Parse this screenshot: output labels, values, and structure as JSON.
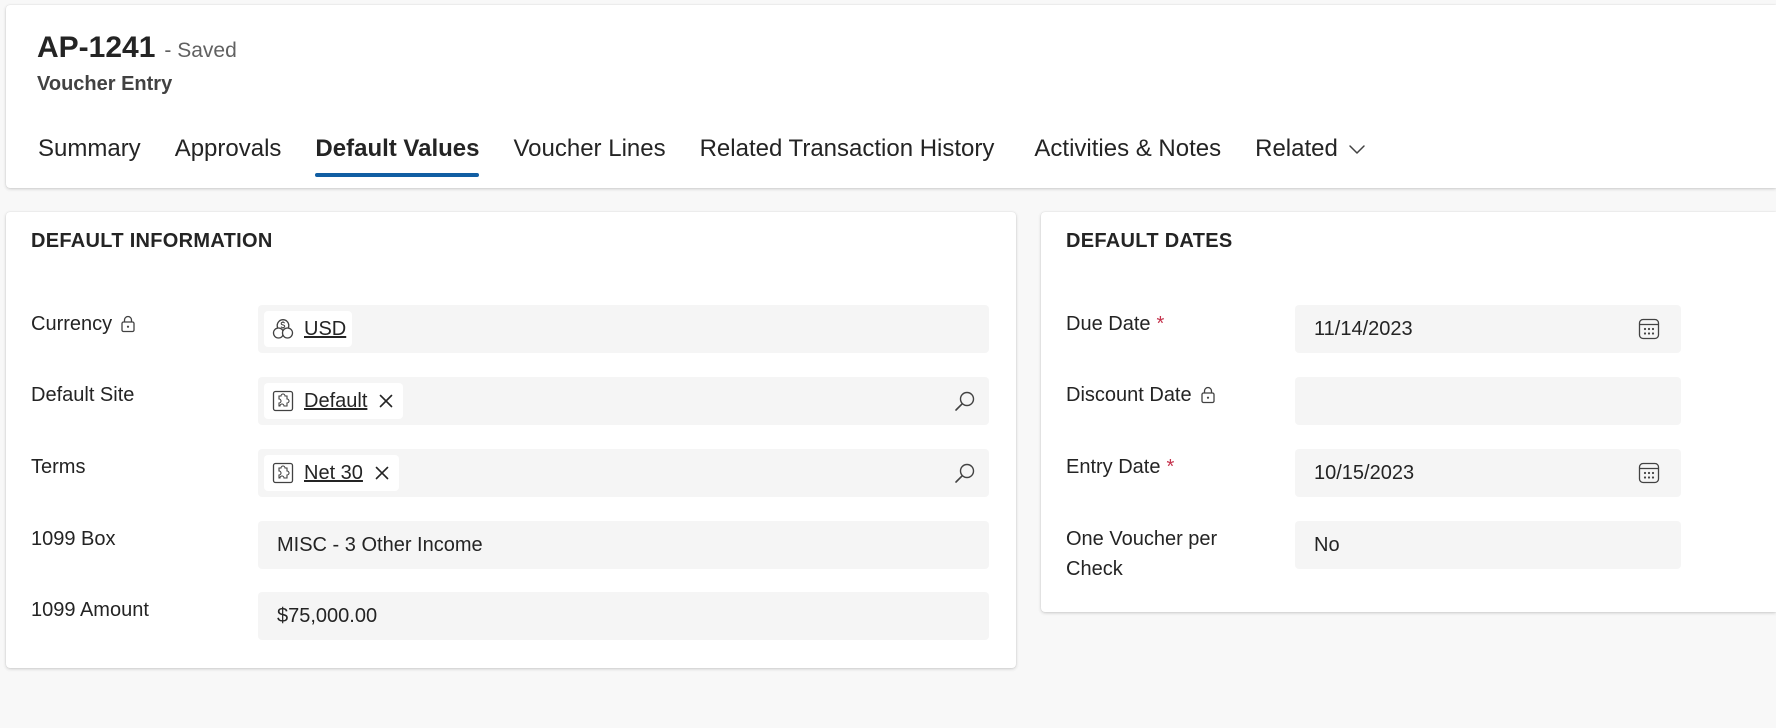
{
  "header": {
    "record_id": "AP-1241",
    "status": "- Saved",
    "entity": "Voucher Entry",
    "tabs": [
      {
        "label": "Summary"
      },
      {
        "label": "Approvals"
      },
      {
        "label": "Default Values",
        "active": true
      },
      {
        "label": "Voucher Lines"
      },
      {
        "label": "Related Transaction History"
      },
      {
        "label": "Activities & Notes"
      },
      {
        "label": "Related"
      }
    ]
  },
  "default_information": {
    "title": "DEFAULT INFORMATION",
    "fields": {
      "currency": {
        "label": "Currency",
        "value": "USD",
        "locked": true
      },
      "default_site": {
        "label": "Default Site",
        "value": "Default"
      },
      "terms": {
        "label": "Terms",
        "value": "Net 30"
      },
      "box_1099": {
        "label": "1099 Box",
        "value": "MISC - 3 Other Income"
      },
      "amount_1099": {
        "label": "1099 Amount",
        "value": "$75,000.00"
      }
    }
  },
  "default_dates": {
    "title": "DEFAULT DATES",
    "fields": {
      "due_date": {
        "label": "Due Date",
        "required_mark": "*",
        "value": "11/14/2023"
      },
      "discount_date": {
        "label": "Discount Date",
        "value": "",
        "locked": true
      },
      "entry_date": {
        "label": "Entry Date",
        "required_mark": "*",
        "value": "10/15/2023"
      },
      "one_voucher_per_check": {
        "label_line1": "One Voucher per",
        "label_line2": "Check",
        "value": "No"
      }
    }
  },
  "icons": {
    "lock": "lock-icon",
    "currency": "coins-icon",
    "entity": "puzzle-icon",
    "remove": "close-icon",
    "search": "search-icon",
    "calendar": "calendar-icon",
    "dropdown": "chevron-down-icon"
  },
  "colors": {
    "accent": "#115ea3",
    "required": "#c4314b",
    "field_bg": "#f5f5f5",
    "page_bg": "#f8f8f8"
  }
}
